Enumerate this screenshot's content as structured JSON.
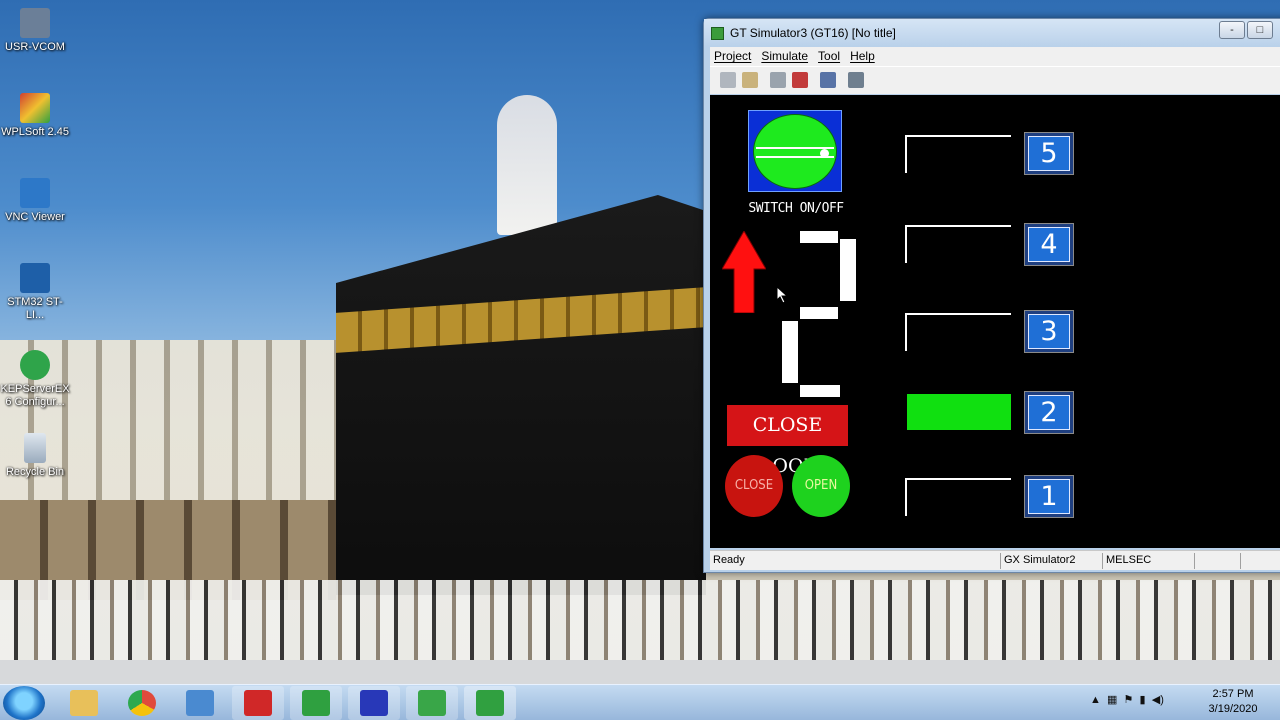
{
  "desktop": {
    "icons": [
      {
        "label": "USR-VCOM",
        "icon": "usr-vcom-icon",
        "color": "#6b7f98"
      },
      {
        "label": "WPLSoft 2.45",
        "icon": "wplsoft-icon",
        "color": "#d04030"
      },
      {
        "label": "VNC Viewer",
        "icon": "vnc-viewer-icon",
        "color": "#2d78c8"
      },
      {
        "label": "STM32 ST-LI...",
        "icon": "stm32-icon",
        "color": "#1e5fa8"
      },
      {
        "label": "KEPServerEX 6 Configur...",
        "icon": "kepserver-icon",
        "color": "#2fa44a"
      },
      {
        "label": "Recycle Bin",
        "icon": "recycle-bin-icon",
        "color": "#b8c6d4"
      }
    ]
  },
  "window": {
    "title": "GT Simulator3 (GT16)  [No title]",
    "menu": [
      "Project",
      "Simulate",
      "Tool",
      "Help"
    ],
    "toolbar_icons": [
      "open-icon",
      "save-icon",
      "device-icon",
      "stop-icon",
      "list-icon",
      "options-icon"
    ],
    "controls": {
      "minimize": "-",
      "maximize": "□",
      "close": "x"
    }
  },
  "hmi": {
    "switch_label": "SWITCH ON/OFF",
    "close_door_label": "CLOSE DOOR",
    "close_lamp_label": "CLOSE",
    "open_lamp_label": "OPEN",
    "floor_display_digit": "2",
    "direction": "up",
    "floors": [
      {
        "number": "5",
        "door_active": false
      },
      {
        "number": "4",
        "door_active": false
      },
      {
        "number": "3",
        "door_active": false
      },
      {
        "number": "2",
        "door_active": true
      },
      {
        "number": "1",
        "door_active": false
      }
    ]
  },
  "status": {
    "ready": "Ready",
    "connection": "GX Simulator2",
    "plc": "MELSEC"
  },
  "taskbar": {
    "apps": [
      {
        "icon": "file-explorer-icon",
        "color": "#e8c05a"
      },
      {
        "icon": "chrome-icon",
        "color": "#e04a3c"
      },
      {
        "icon": "network-icon",
        "color": "#4a8ad0"
      },
      {
        "icon": "gx-works-icon",
        "color": "#d02828"
      },
      {
        "icon": "gt-designer-icon",
        "color": "#2fa040"
      },
      {
        "icon": "gt-simulator-icon",
        "color": "#2838b8"
      },
      {
        "icon": "gx-simulator-icon",
        "color": "#39a648"
      },
      {
        "icon": "gt-simulator3-icon",
        "color": "#30a040"
      }
    ],
    "time": "2:57 PM",
    "date": "3/19/2020"
  }
}
